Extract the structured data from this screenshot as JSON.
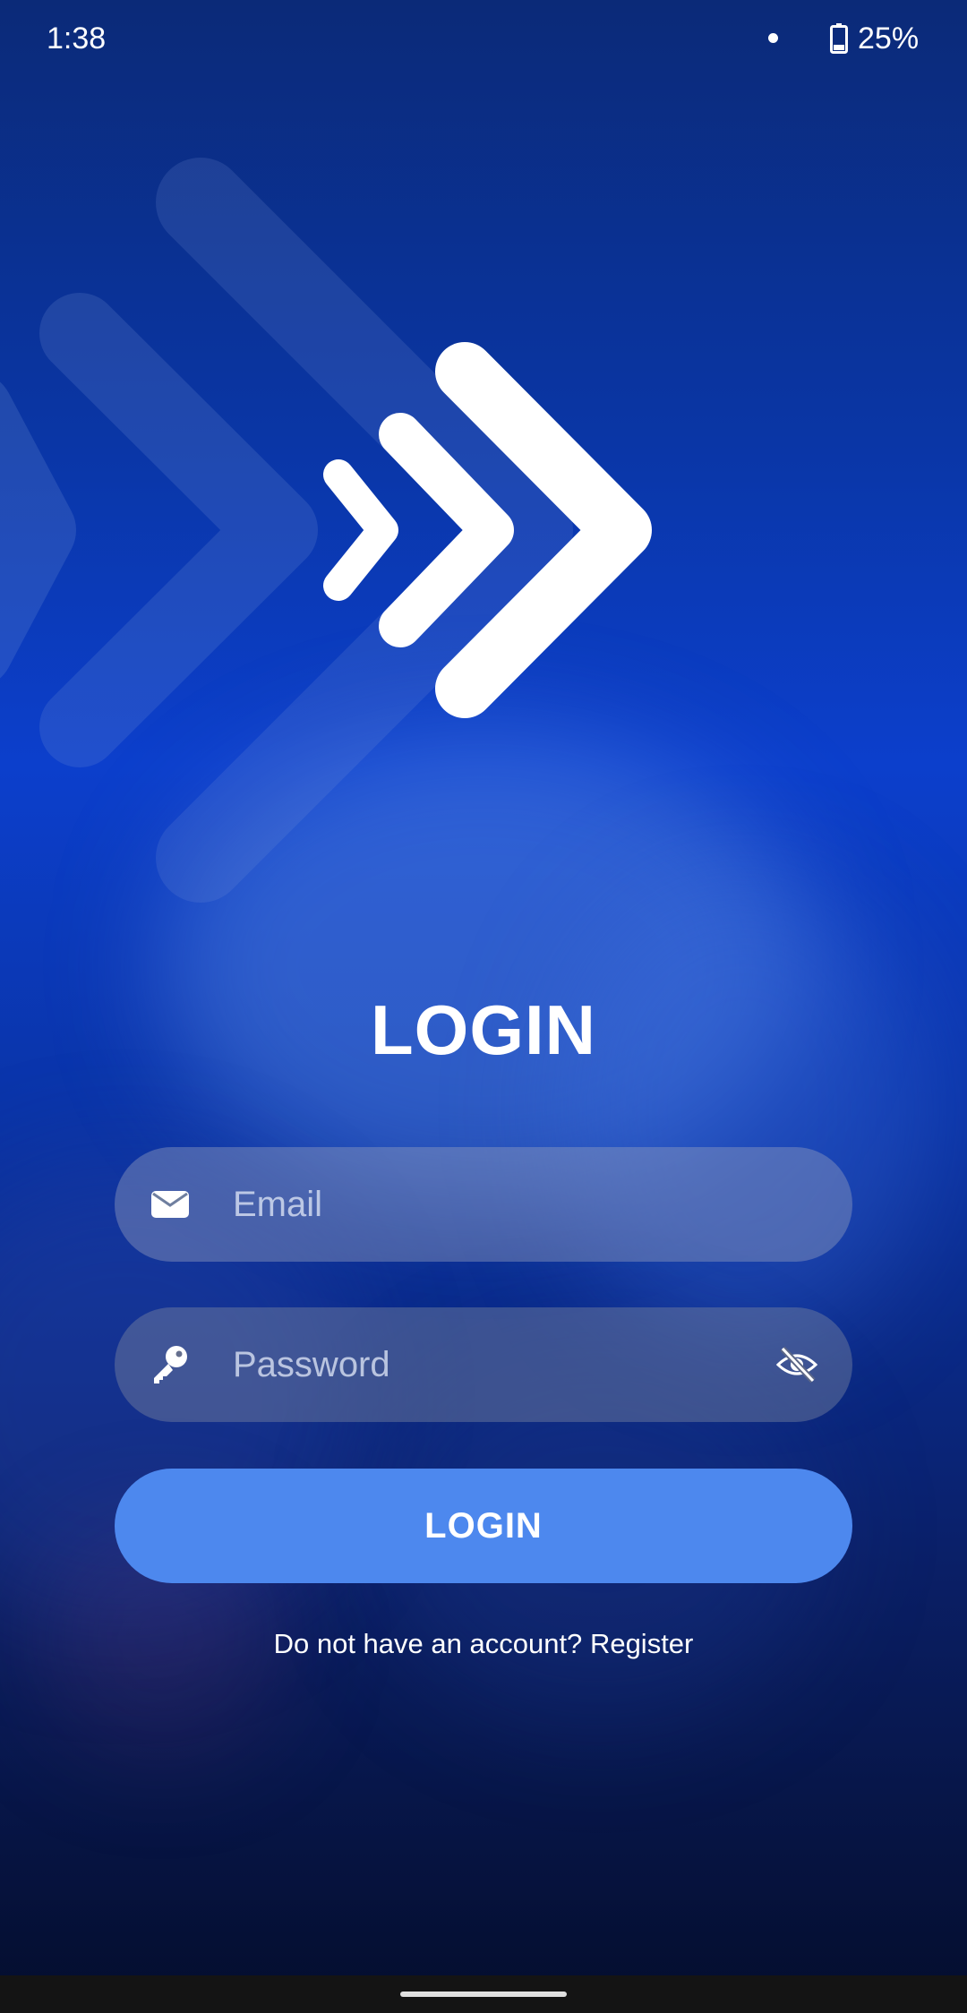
{
  "status_bar": {
    "time": "1:38",
    "battery": "25%"
  },
  "login": {
    "title": "LOGIN",
    "email_placeholder": "Email",
    "password_placeholder": "Password",
    "button_label": "LOGIN",
    "no_account_text": "Do not have an account?",
    "register_label": "Register"
  },
  "colors": {
    "button": "#4d88ee",
    "background_top": "#0b2a78",
    "background_mid": "#0c3fcc",
    "background_bottom": "#040d2c"
  },
  "icons": [
    "battery-icon",
    "app-logo-icon",
    "email-icon",
    "key-icon",
    "eye-off-icon"
  ]
}
